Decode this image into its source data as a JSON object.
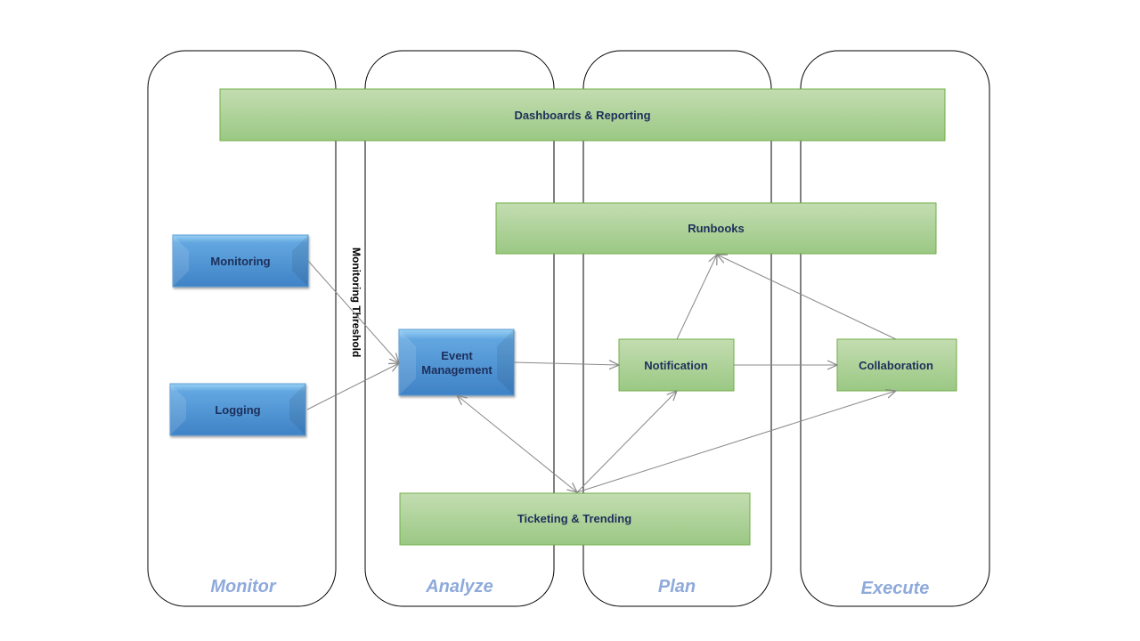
{
  "lanes": [
    {
      "label": "Monitor"
    },
    {
      "label": "Analyze"
    },
    {
      "label": "Plan"
    },
    {
      "label": "Execute"
    }
  ],
  "boxes": {
    "dashboards": "Dashboards & Reporting",
    "runbooks": "Runbooks",
    "monitoring": "Monitoring",
    "logging": "Logging",
    "event_line1": "Event",
    "event_line2": "Management",
    "notification": "Notification",
    "collaboration": "Collaboration",
    "ticketing": "Ticketing & Trending"
  },
  "threshold_label": "Monitoring Threshold",
  "colors": {
    "lane_label": "#8eaadb",
    "green_top": "#c0dcae",
    "green_bottom": "#9cc985",
    "green_border": "#70ad47",
    "blue_top": "#8fc8f0",
    "blue_bottom": "#3f85c8",
    "arrow": "#888888"
  }
}
